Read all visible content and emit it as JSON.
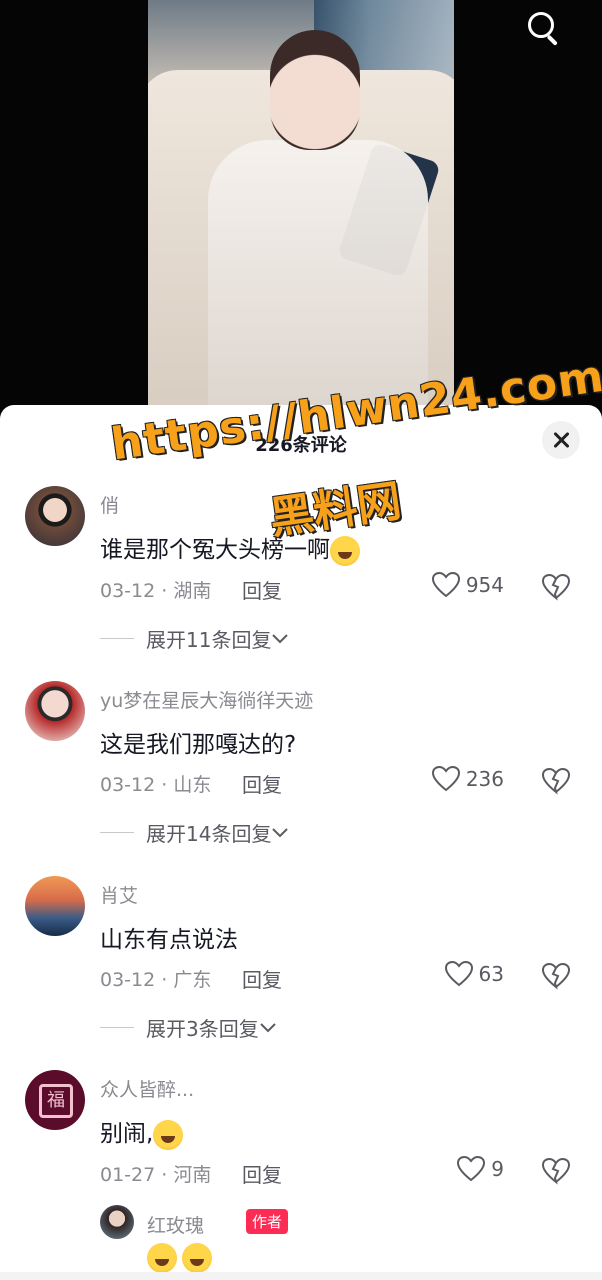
{
  "header": {
    "comment_count_title": "226条评论"
  },
  "watermark": {
    "url": "https://hlwn24.com",
    "name": "黑料网"
  },
  "icons": {
    "search": "search-icon",
    "close": "close-icon",
    "heart": "heart-icon",
    "dislike": "broken-heart-icon",
    "chevron": "chevron-down-icon",
    "emoji": "laughing-emoji-icon"
  },
  "comments": [
    {
      "username": "俏",
      "text": "谁是那个冤大头榜一啊",
      "date": "03-12",
      "location": "湖南",
      "reply_label": "回复",
      "likes": "954",
      "expand_label": "展开11条回复"
    },
    {
      "username": "yu梦在星辰大海徜徉天迹",
      "text": "这是我们那嘎达的?",
      "date": "03-12",
      "location": "山东",
      "reply_label": "回复",
      "likes": "236",
      "expand_label": "展开14条回复"
    },
    {
      "username": "肖艾",
      "text": "山东有点说法",
      "date": "03-12",
      "location": "广东",
      "reply_label": "回复",
      "likes": "63",
      "expand_label": "展开3条回复"
    },
    {
      "username": "众人皆醉...",
      "text": "别闹,",
      "date": "01-27",
      "location": "河南",
      "reply_label": "回复",
      "likes": "9"
    }
  ],
  "reply": {
    "username": "红玫瑰",
    "badge": "作者"
  },
  "colors": {
    "accent": "#fe2c55",
    "watermark": "#f7a11a"
  }
}
